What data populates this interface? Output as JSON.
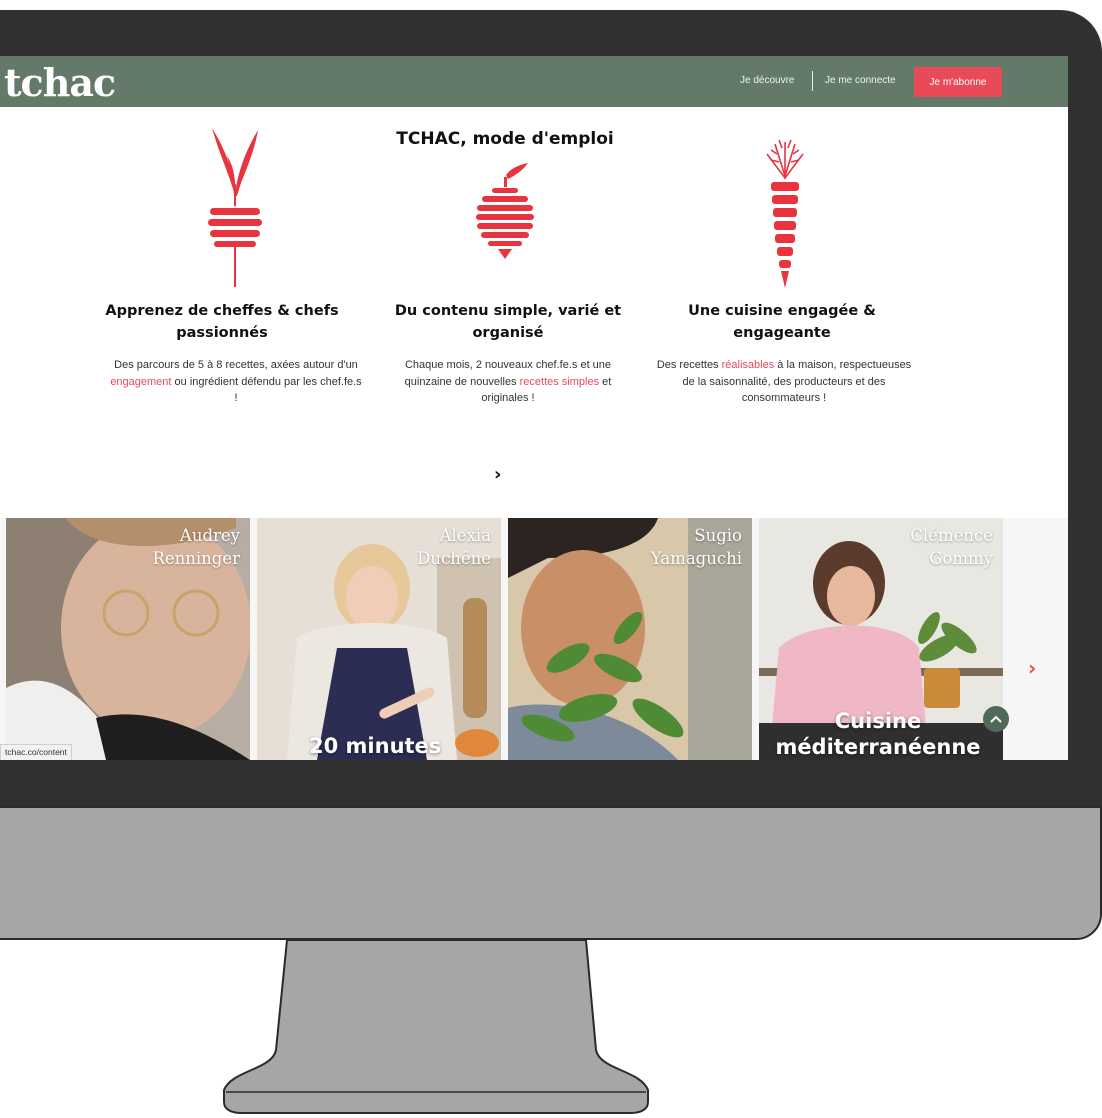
{
  "header": {
    "logo": "tchac",
    "links": [
      "Je découvre",
      "Je me connecte"
    ],
    "cta": "Je m'abonne"
  },
  "intro": {
    "title": "TCHAC, mode d'emploi",
    "columns": [
      {
        "icon": "beetroot-icon",
        "title": "Apprenez de cheffes & chefs passionnés",
        "text_before": "Des parcours de 5 à 8 recettes, axées autour d'un ",
        "highlight": "engagement",
        "text_after": " ou ingrédient défendu par les chef.fe.s !"
      },
      {
        "icon": "onion-icon",
        "title": "Du contenu simple, varié et organisé",
        "text_before": "Chaque mois, 2 nouveaux chef.fe.s et une quinzaine de nouvelles ",
        "highlight": "recettes simples",
        "text_after": " et originales !"
      },
      {
        "icon": "carrot-icon",
        "title": "Une cuisine engagée & engageante",
        "text_before": "Des recettes ",
        "highlight": "réalisables",
        "text_after": " à la maison, respectueuses de la saisonnalité, des producteurs et des consommateurs !"
      }
    ],
    "next": "›"
  },
  "cards": [
    {
      "first": "Audrey",
      "last": "Renninger",
      "tag": ""
    },
    {
      "first": "Alexia",
      "last": "Duchêne",
      "tag": "20 minutes"
    },
    {
      "first": "Sugio",
      "last": "Yamaguchi",
      "tag": ""
    },
    {
      "first": "Clémence",
      "last": "Gommy",
      "tag": "Cuisine méditerranéenne"
    }
  ],
  "carousel_next": "›",
  "scroll_top": "^",
  "status_url": "tchac.co/content",
  "colors": {
    "nav": "#637a68",
    "accent": "#e94a58",
    "bezel": "#303030",
    "chin": "#a6a6a6"
  }
}
